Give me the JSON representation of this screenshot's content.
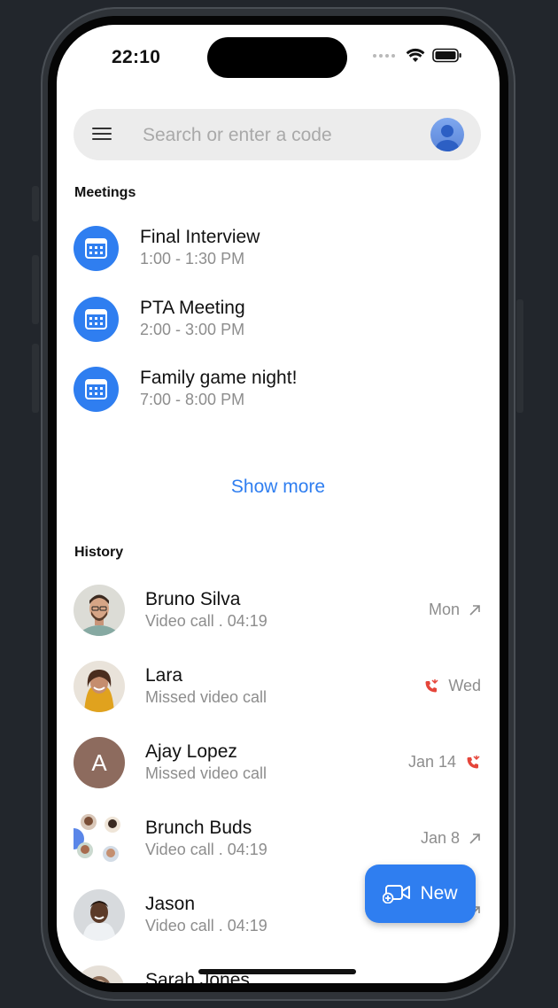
{
  "status": {
    "time": "22:10"
  },
  "search": {
    "placeholder": "Search or enter a code"
  },
  "meetings": {
    "title": "Meetings",
    "items": [
      {
        "title": "Final Interview",
        "time": "1:00 - 1:30 PM"
      },
      {
        "title": "PTA Meeting",
        "time": "2:00 - 3:00 PM"
      },
      {
        "title": "Family game night!",
        "time": "7:00 - 8:00 PM"
      }
    ],
    "show_more": "Show more"
  },
  "history": {
    "title": "History",
    "items": [
      {
        "name": "Bruno Silva",
        "subtitle": "Video call . 04:19",
        "date": "Mon",
        "call_icon": "outgoing-arrow-icon"
      },
      {
        "name": "Lara",
        "subtitle": "Missed video call",
        "date": "Wed",
        "call_icon": "missed-call-icon"
      },
      {
        "name": "Ajay Lopez",
        "initial": "A",
        "subtitle": "Missed video call",
        "date": "Jan 14",
        "call_icon": "missed-call-icon"
      },
      {
        "name": "Brunch Buds",
        "subtitle": "Video call . 04:19",
        "date": "Jan 8",
        "call_icon": "outgoing-arrow-icon"
      },
      {
        "name": "Jason",
        "subtitle": "Video call . 04:19",
        "date": "",
        "call_icon": "outgoing-arrow-icon"
      },
      {
        "name": "Sarah Jones",
        "subtitle": "",
        "date": "",
        "call_icon": ""
      }
    ]
  },
  "fab": {
    "label": "New",
    "icon": "new-video-call-icon"
  },
  "colors": {
    "accent": "#2f7ef0",
    "missed": "#e5453a",
    "background": "#22262c"
  }
}
